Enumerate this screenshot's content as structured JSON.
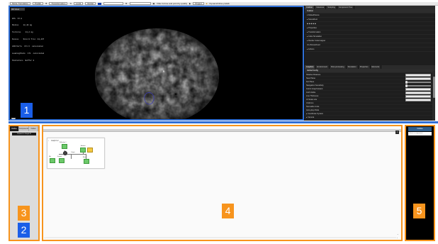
{
  "toolbar": {
    "mode_label": "Mode Translation",
    "snap_label": "Prefab",
    "transform_label": "Transformation",
    "local_label": "Local",
    "pivot_label": "Global",
    "status_text": "Filter & time and point by quality",
    "play_label": "Project",
    "scene_label": "DynamicInline.prefab"
  },
  "viewport": {
    "tab_label": "3D View",
    "stats_lines": [
      "FPS  57.0",
      "Meshes    12,40 mg",
      "Textures    14,2 mg",
      "Scenes    Size:0 Tris: 44,437",
      "LOD/Verts  171 K  calculated",
      "LoadingState  171  calculated",
      "Statistics  Buffer 0"
    ]
  },
  "right_dock": {
    "top_tabs": [
      "Outliner",
      "Instances",
      "Sculpting",
      "Component Tree"
    ],
    "tree_header": "Outliner",
    "tree_rows": [
      "▾ DefaultScene",
      "   ▸ SceneRoot",
      "   ◆ ◆ ◆ ◆ ◆",
      "▸ Properties",
      "▸ Transformation",
      "▸ Cube Simulation",
      "▸ Render Colormapper",
      "Un-thinned/med",
      "▸ Actions"
    ],
    "props_tabs": [
      "Graphics",
      "Environment",
      "Post-processing",
      "Simulation",
      "Properties",
      "Elements"
    ],
    "props_header": "Global Config",
    "props_rows": [
      {
        "label": "Shadow Distance",
        "kind": "field"
      },
      {
        "label": "Near Plane",
        "kind": "field"
      },
      {
        "label": "Far Plane",
        "kind": "slider"
      },
      {
        "label": "Navigation Sensitivity",
        "kind": "slider"
      },
      {
        "label": "Grid & Graph Extent",
        "kind": "field"
      },
      {
        "label": "Grid Visible",
        "kind": "field"
      },
      {
        "label": "Line Thickness",
        "kind": "field"
      },
      {
        "label": "UI Scale size",
        "kind": "field"
      },
      {
        "label": "Uniforms",
        "kind": "none"
      },
      {
        "label": "Normalize Units",
        "kind": "none"
      },
      {
        "label": "Auto-play Mode",
        "kind": "none"
      },
      {
        "label": "▸ Coordinate System",
        "kind": "none"
      },
      {
        "label": "▸ Camera",
        "kind": "none"
      }
    ]
  },
  "left_panel": {
    "tabs": [
      "Outline",
      "Components",
      "Nodes"
    ],
    "button_label": "Connect to Graph IO"
  },
  "editor": {
    "graph_title": "Graph 0.2",
    "node_labels": [
      "Reflection 1",
      "Ambient",
      "Mix",
      "Fresnel",
      "Output",
      "Blend"
    ]
  },
  "right_panel": {
    "header": "Outline",
    "field_text": "Select a component"
  },
  "badges": [
    "1",
    "2",
    "3",
    "4",
    "5"
  ],
  "colors": {
    "blue_highlight": "#2f6fd6",
    "orange_highlight": "#f7941d",
    "badge_blue": "#1a5ee8"
  }
}
